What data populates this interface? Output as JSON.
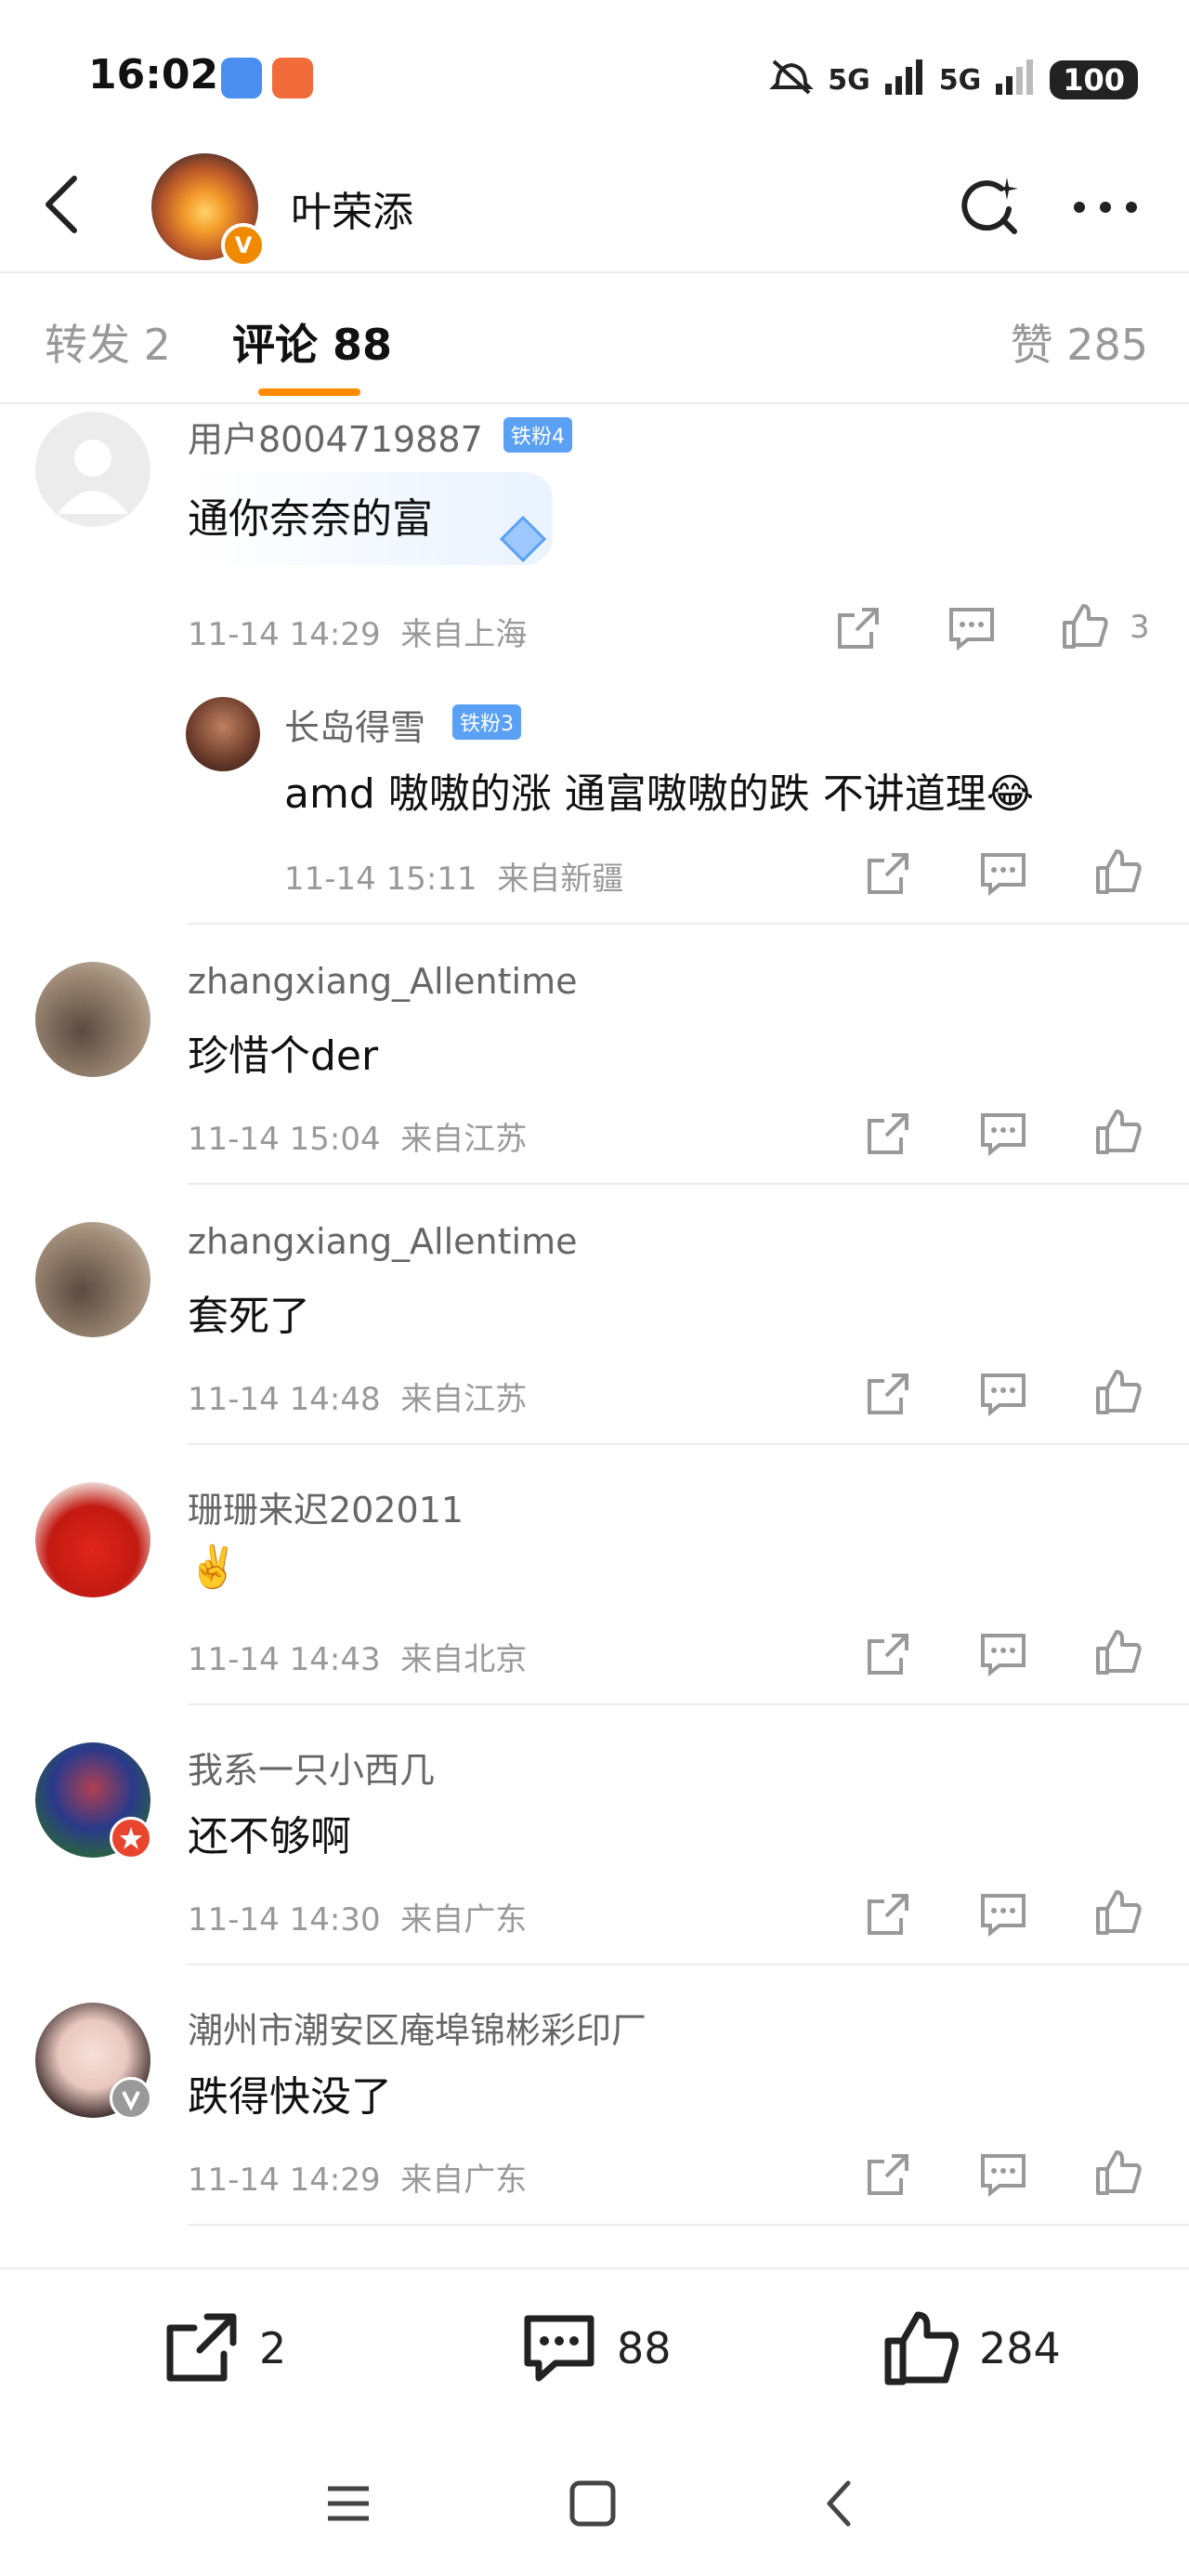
{
  "status_bar": {
    "time": "16:02",
    "signal1": "5G",
    "signal2": "5G",
    "battery": "100"
  },
  "header": {
    "title": "叶荣添",
    "verified_badge": "V"
  },
  "tabs": [
    {
      "label": "转发 2"
    },
    {
      "label": "评论 88"
    },
    {
      "label": "赞 285"
    }
  ],
  "comments": [
    {
      "name": "用户8004719887",
      "badge": "铁粉4",
      "text": "通你奈奈的富",
      "time": "11-14 14:29",
      "location": "来自上海",
      "likes": "3",
      "reply": {
        "name": "长岛得雪",
        "badge": "铁粉3",
        "text": "amd 嗷嗷的涨 通富嗷嗷的跌 不讲道理😂",
        "time": "11-14 15:11",
        "location": "来自新疆"
      }
    },
    {
      "name": "zhangxiang_Allentime",
      "text": "珍惜个der",
      "time": "11-14 15:04",
      "location": "来自江苏"
    },
    {
      "name": "zhangxiang_Allentime",
      "text": "套死了",
      "time": "11-14 14:48",
      "location": "来自江苏"
    },
    {
      "name": "珊珊来迟202011",
      "text": "✌️",
      "time": "11-14 14:43",
      "location": "来自北京"
    },
    {
      "name": "我系一只小西几",
      "text": "还不够啊",
      "time": "11-14 14:30",
      "location": "来自广东"
    },
    {
      "name": "潮州市潮安区庵埠锦彬彩印厂",
      "text": "跌得快没了",
      "time": "11-14 14:29",
      "location": "来自广东"
    }
  ],
  "bottom": {
    "reposts": "2",
    "comments": "88",
    "likes": "284"
  },
  "colors": {
    "accent": "#ff8a00",
    "fan_badge": "#5aa0f5"
  }
}
